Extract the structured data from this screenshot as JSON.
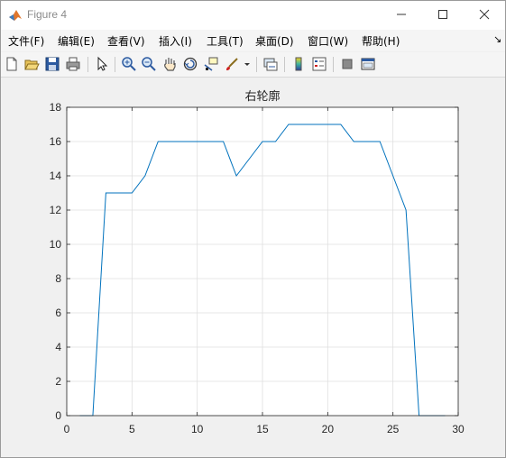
{
  "window": {
    "title": "Figure 4",
    "minimize_icon": "minimize-icon",
    "maximize_icon": "maximize-icon",
    "close_icon": "close-icon"
  },
  "menu": {
    "items": [
      {
        "label": "文件(F)"
      },
      {
        "label": "编辑(E)"
      },
      {
        "label": "查看(V)"
      },
      {
        "label": "插入(I)"
      },
      {
        "label": "工具(T)"
      },
      {
        "label": "桌面(D)"
      },
      {
        "label": "窗口(W)"
      },
      {
        "label": "帮助(H)"
      }
    ],
    "expand_glyph": "↘"
  },
  "toolbar": {
    "icons": [
      "new-figure-icon",
      "open-file-icon",
      "save-icon",
      "print-icon",
      "pointer-icon",
      "zoom-in-icon",
      "zoom-out-icon",
      "pan-hand-icon",
      "rotate-3d-icon",
      "data-cursor-icon",
      "brush-icon",
      "brush-dropdown-icon",
      "link-plot-icon",
      "colorbar-icon",
      "legend-icon",
      "hide-plot-tools-icon",
      "show-plot-tools-icon"
    ]
  },
  "colors": {
    "line": "#0072bd",
    "grid": "#dfdfdf",
    "axes": "#262626",
    "figure_bg": "#f0f0f0"
  },
  "chart_data": {
    "type": "line",
    "title": "右轮廓",
    "xlabel": "",
    "ylabel": "",
    "xlim": [
      0,
      30
    ],
    "ylim": [
      0,
      18
    ],
    "xticks": [
      0,
      5,
      10,
      15,
      20,
      25,
      30
    ],
    "yticks": [
      0,
      2,
      4,
      6,
      8,
      10,
      12,
      14,
      16,
      18
    ],
    "grid": true,
    "series": [
      {
        "x": [
          1,
          2,
          3,
          4,
          5,
          6,
          7,
          8,
          9,
          10,
          11,
          12,
          13,
          14,
          15,
          16,
          17,
          18,
          19,
          20,
          21,
          22,
          23,
          24,
          25,
          26,
          27,
          28,
          29
        ],
        "y": [
          0,
          0,
          13,
          13,
          13,
          14,
          16,
          16,
          16,
          16,
          16,
          16,
          14,
          15,
          16,
          16,
          17,
          17,
          17,
          17,
          17,
          16,
          16,
          16,
          14,
          12,
          0,
          0,
          0
        ]
      }
    ]
  }
}
